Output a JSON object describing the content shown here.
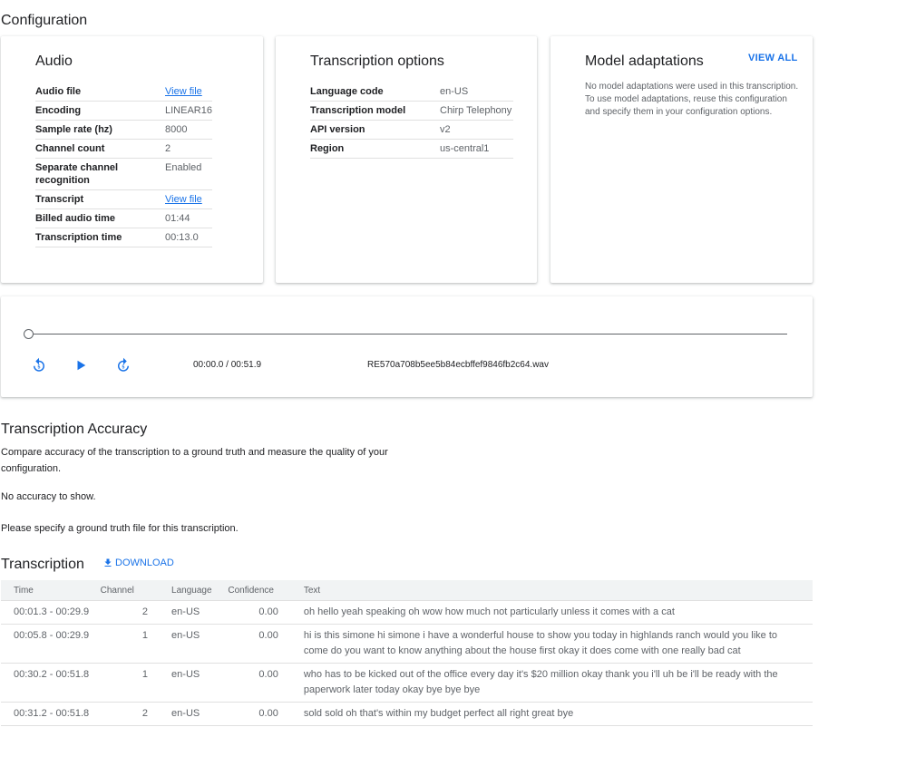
{
  "configuration": {
    "title": "Configuration",
    "audio": {
      "title": "Audio",
      "rows": [
        {
          "key": "Audio file",
          "value": "View file",
          "link": true
        },
        {
          "key": "Encoding",
          "value": "LINEAR16"
        },
        {
          "key": "Sample rate (hz)",
          "value": "8000"
        },
        {
          "key": "Channel count",
          "value": "2"
        },
        {
          "key": "Separate channel recognition",
          "value": "Enabled"
        },
        {
          "key": "Transcript",
          "value": "View file",
          "link": true
        },
        {
          "key": "Billed audio time",
          "value": "01:44"
        },
        {
          "key": "Transcription time",
          "value": "00:13.0"
        }
      ]
    },
    "transcription_options": {
      "title": "Transcription options",
      "rows": [
        {
          "key": "Language code",
          "value": "en-US"
        },
        {
          "key": "Transcription model",
          "value": "Chirp Telephony"
        },
        {
          "key": "API version",
          "value": "v2"
        },
        {
          "key": "Region",
          "value": "us-central1"
        }
      ]
    },
    "model_adaptations": {
      "title": "Model adaptations",
      "view_all": "VIEW ALL",
      "description": "No model adaptations were used in this transcription. To use model adaptations, reuse this configuration and specify them in your configuration options."
    }
  },
  "player": {
    "time_readout": "00:00.0 / 00:51.9",
    "file_name": "RE570a708b5ee5b84ecbffef9846fb2c64.wav",
    "progress": 0,
    "icons": [
      "replay-5-icon",
      "play-icon",
      "forward-5-icon"
    ]
  },
  "accuracy": {
    "title": "Transcription Accuracy",
    "description_line1": "Compare accuracy of the transcription to a ground truth and measure the quality of your",
    "description_line2": "configuration.",
    "no_accuracy": "No accuracy to show.",
    "hint": "Please specify a ground truth file for this transcription."
  },
  "transcription": {
    "title": "Transcription",
    "download_label": "DOWNLOAD",
    "columns": [
      "Time",
      "Channel",
      "Language",
      "Confidence",
      "Text"
    ],
    "rows": [
      {
        "time": "00:01.3 - 00:29.9",
        "channel": "2",
        "language": "en-US",
        "confidence": "0.00",
        "text": "oh hello yeah speaking oh wow how much not particularly unless it comes with a cat"
      },
      {
        "time": "00:05.8 - 00:29.9",
        "channel": "1",
        "language": "en-US",
        "confidence": "0.00",
        "text": "hi is this simone hi simone i have a wonderful house to show you today in highlands ranch would you like to come do you want to know anything about the house first okay it does come with one really bad cat"
      },
      {
        "time": "00:30.2 - 00:51.8",
        "channel": "1",
        "language": "en-US",
        "confidence": "0.00",
        "text": "who has to be kicked out of the office every day it's $20 million okay thank you i'll uh be i'll be ready with the paperwork later today okay bye bye bye"
      },
      {
        "time": "00:31.2 - 00:51.8",
        "channel": "2",
        "language": "en-US",
        "confidence": "0.00",
        "text": "sold sold oh that's within my budget perfect all right great bye"
      }
    ]
  },
  "colors": {
    "accent": "#1a73e8",
    "text_primary": "#202124",
    "text_secondary": "#5f6368",
    "header_bg": "#f1f3f4",
    "divider": "#e0e0e0"
  }
}
